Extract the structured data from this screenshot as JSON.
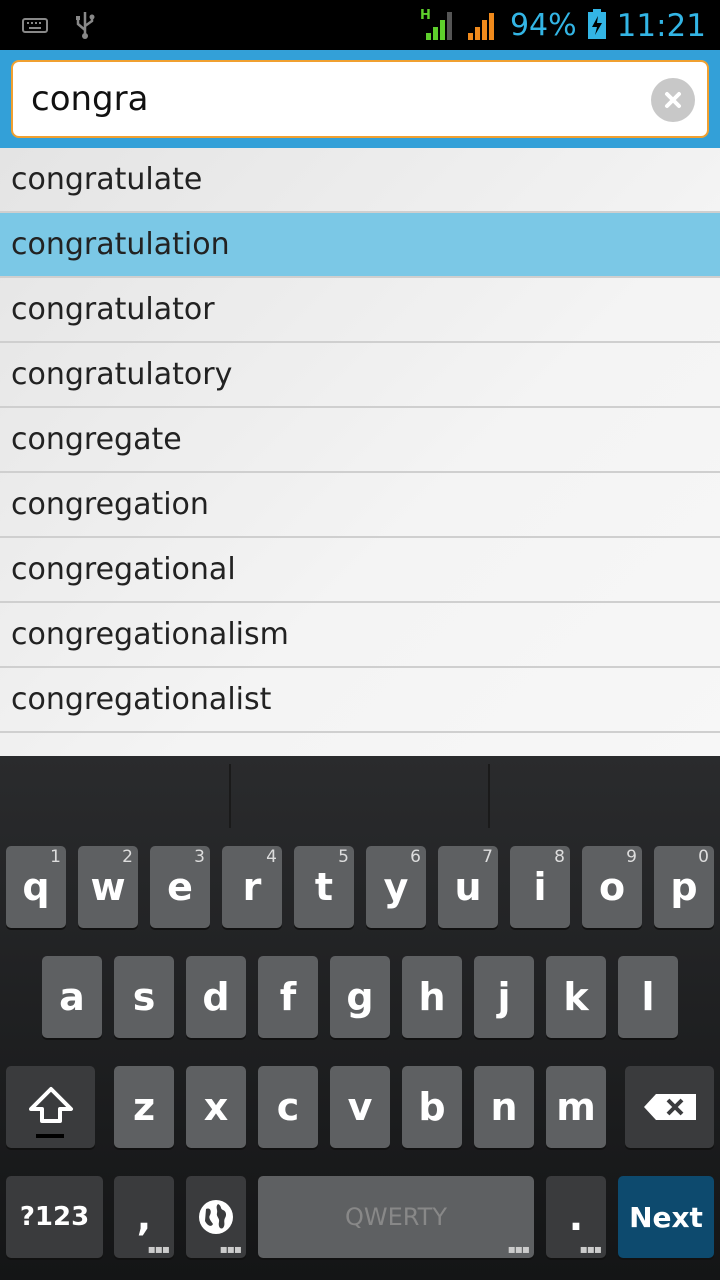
{
  "status_bar": {
    "battery": "94%",
    "time": "11:21",
    "icons": [
      "keyboard-icon",
      "usb-icon",
      "signal-h-icon",
      "signal-icon",
      "battery-charging-icon"
    ],
    "accent": "#33b5e5"
  },
  "search": {
    "value": "congra"
  },
  "suggestions": [
    "congratulate",
    "congratulation",
    "congratulator",
    "congratulatory",
    "congregate",
    "congregation",
    "congregational",
    "congregationalism",
    "congregationalist"
  ],
  "selected_index": 1,
  "keyboard": {
    "row1": [
      {
        "k": "q",
        "h": "1"
      },
      {
        "k": "w",
        "h": "2"
      },
      {
        "k": "e",
        "h": "3"
      },
      {
        "k": "r",
        "h": "4"
      },
      {
        "k": "t",
        "h": "5"
      },
      {
        "k": "y",
        "h": "6"
      },
      {
        "k": "u",
        "h": "7"
      },
      {
        "k": "i",
        "h": "8"
      },
      {
        "k": "o",
        "h": "9"
      },
      {
        "k": "p",
        "h": "0"
      }
    ],
    "row2": [
      "a",
      "s",
      "d",
      "f",
      "g",
      "h",
      "j",
      "k",
      "l"
    ],
    "row3": [
      "z",
      "x",
      "c",
      "v",
      "b",
      "n",
      "m"
    ],
    "symbols_label": "?123",
    "comma_label": ",",
    "space_label": "QWERTY",
    "period_label": ".",
    "next_label": "Next"
  },
  "colors": {
    "header": "#33a0d8",
    "selected_row": "#7bc8e6",
    "next_key": "#0d4a6e"
  }
}
